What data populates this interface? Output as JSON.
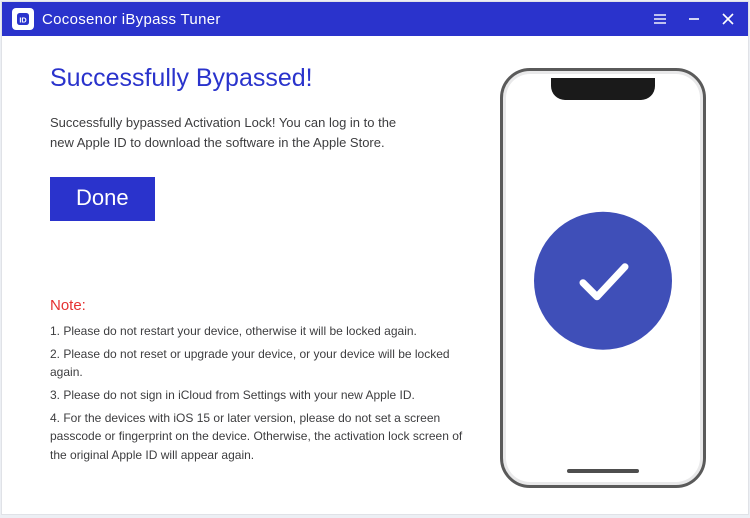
{
  "titlebar": {
    "title": "Cocosenor iBypass Tuner"
  },
  "main": {
    "heading": "Successfully Bypassed!",
    "description": "Successfully bypassed Activation Lock! You can log in to the new Apple ID to download the software in the Apple Store.",
    "done_label": "Done"
  },
  "note": {
    "title": "Note:",
    "items": [
      "1. Please do not restart your device, otherwise it will be locked again.",
      "2. Please do not reset or upgrade your device, or your device will be locked again.",
      "3. Please do not sign in iCloud from Settings with your new Apple ID.",
      "4. For the devices with iOS 15 or later version, please do not set a screen passcode or fingerprint on the device. Otherwise, the activation lock screen of the original Apple ID will appear again."
    ]
  }
}
